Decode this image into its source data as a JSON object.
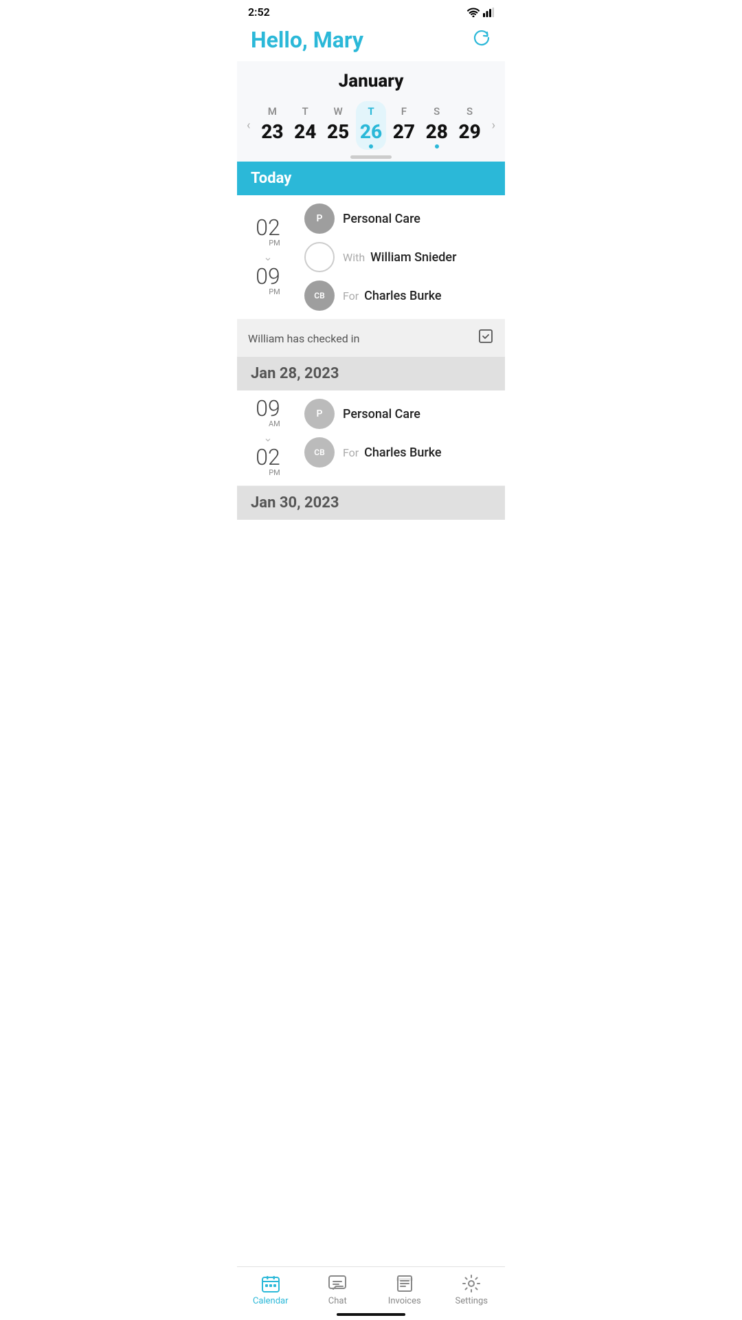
{
  "statusBar": {
    "time": "2:52",
    "icons": [
      "sim",
      "wifi",
      "signal"
    ]
  },
  "header": {
    "greeting": "Hello, Mary",
    "refreshLabel": "refresh"
  },
  "calendar": {
    "month": "January",
    "weekDays": [
      {
        "letter": "M",
        "num": "23",
        "active": false,
        "hasDot": false
      },
      {
        "letter": "T",
        "num": "24",
        "active": false,
        "hasDot": false
      },
      {
        "letter": "W",
        "num": "25",
        "active": false,
        "hasDot": false
      },
      {
        "letter": "T",
        "num": "26",
        "active": true,
        "hasDot": true
      },
      {
        "letter": "F",
        "num": "27",
        "active": false,
        "hasDot": false
      },
      {
        "letter": "S",
        "num": "28",
        "active": false,
        "hasDot": true
      },
      {
        "letter": "S",
        "num": "29",
        "active": false,
        "hasDot": false
      }
    ]
  },
  "sections": [
    {
      "header": "Today",
      "headerColor": "blue",
      "timeStart": "02",
      "timeSuffixStart": "PM",
      "timeEnd": "09",
      "timeSuffixEnd": "PM",
      "appointments": [
        {
          "avatar": "P",
          "avatarEmpty": false,
          "serviceType": "Personal Care",
          "withLabel": "",
          "workerName": ""
        },
        {
          "avatar": "",
          "avatarEmpty": true,
          "serviceType": "",
          "withLabel": "With",
          "workerName": "William Snieder"
        },
        {
          "avatar": "CB",
          "avatarEmpty": false,
          "serviceType": "",
          "withLabel": "For",
          "workerName": "Charles Burke"
        }
      ],
      "checkIn": {
        "text": "William has checked in",
        "show": true
      }
    },
    {
      "header": "Jan 28, 2023",
      "headerColor": "gray",
      "timeStart": "09",
      "timeSuffixStart": "AM",
      "timeEnd": "02",
      "timeSuffixEnd": "PM",
      "appointments": [
        {
          "avatar": "P",
          "avatarEmpty": false,
          "serviceType": "Personal Care",
          "withLabel": "",
          "workerName": ""
        },
        {
          "avatar": "CB",
          "avatarEmpty": false,
          "serviceType": "",
          "withLabel": "For",
          "workerName": "Charles Burke"
        }
      ],
      "checkIn": {
        "text": "",
        "show": false
      }
    },
    {
      "header": "Jan 30, 2023",
      "headerColor": "gray",
      "appointments": []
    }
  ],
  "bottomNav": {
    "items": [
      {
        "label": "Calendar",
        "active": true
      },
      {
        "label": "Chat",
        "active": false
      },
      {
        "label": "Invoices",
        "active": false
      },
      {
        "label": "Settings",
        "active": false
      }
    ]
  }
}
